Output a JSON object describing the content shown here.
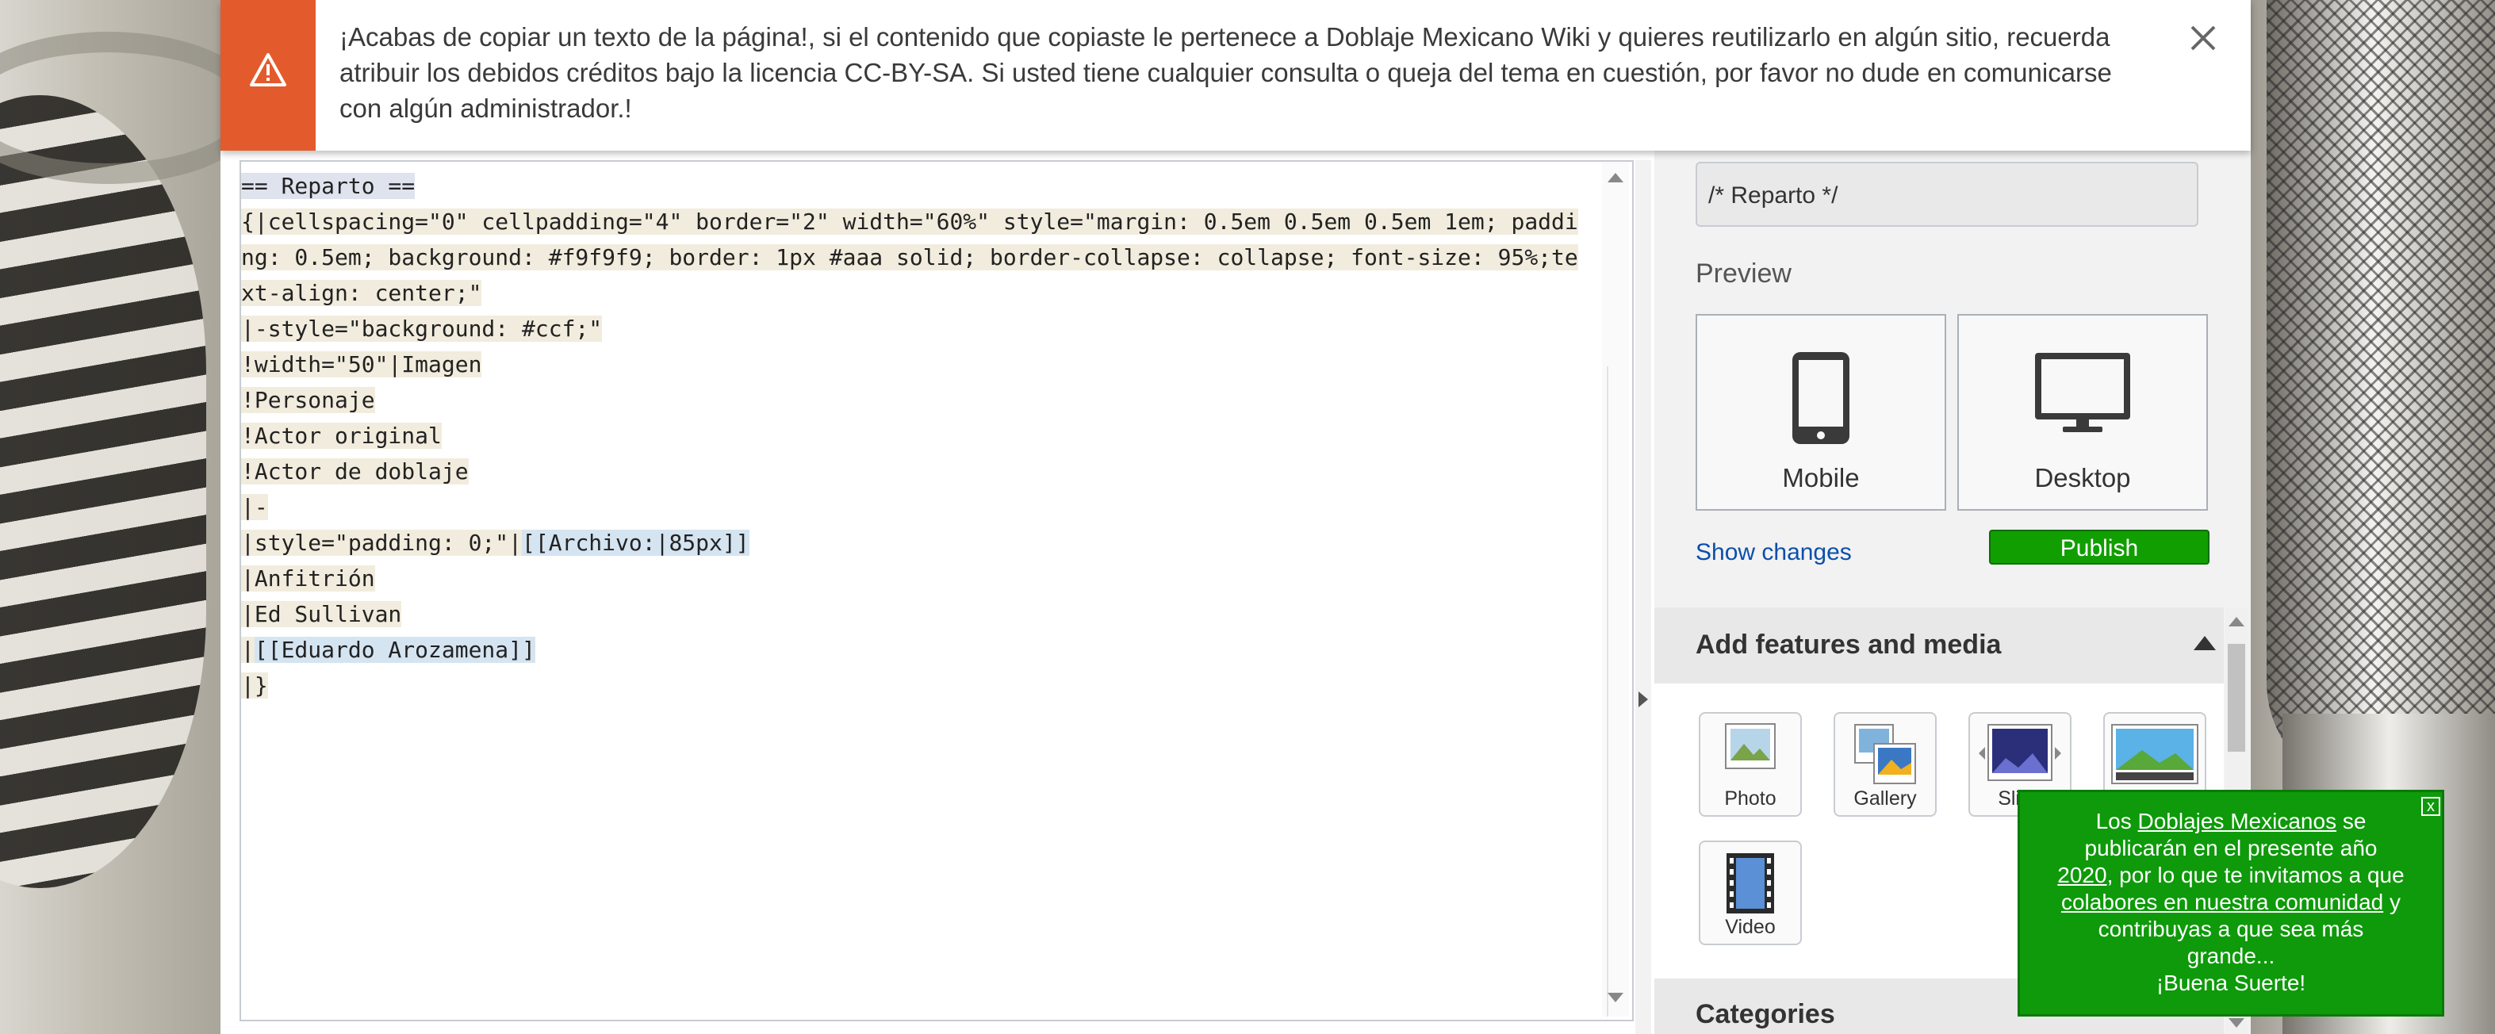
{
  "notice": {
    "message": "¡Acabas de copiar un texto de la página!, si el contenido que copiaste le pertenece a Doblaje Mexicano Wiki y quieres reutilizarlo en algún sitio, recuerda atribuir los debidos créditos bajo la licencia CC-BY-SA. Si usted tiene cualquier consulta o queja del tema en cuestión, por favor no dude en comunicarse con algún administrador.!",
    "accent_color": "#e35b2c",
    "icon": "warning-icon"
  },
  "source": {
    "lines": [
      {
        "text": "== Reparto ==",
        "style": "head"
      },
      {
        "text": "{|cellspacing=\"0\" cellpadding=\"4\" border=\"2\" width=\"60%\" style=\"margin: 0.5em 0.5em 0.5em 1em; padding: 0.5em; background: #f9f9f9; border: 1px #aaa solid; border-collapse: collapse; font-size: 95%;text-align: center;\"",
        "style": "hl"
      },
      {
        "text": "|-style=\"background: #ccf;\"",
        "style": "hl"
      },
      {
        "text": "!width=\"50\"|Imagen",
        "style": "hl"
      },
      {
        "text": "!Personaje",
        "style": "hl"
      },
      {
        "text": "!Actor original",
        "style": "hl"
      },
      {
        "text": "!Actor de doblaje",
        "style": "hl"
      },
      {
        "text": "|-",
        "style": "hl"
      },
      {
        "text": "|style=\"padding: 0;\"|",
        "style": "hl",
        "link": "[[Archivo:|85px]]"
      },
      {
        "text": "|Anfitrión",
        "style": "hl"
      },
      {
        "text": "|Ed Sullivan",
        "style": "hl"
      },
      {
        "text": "|",
        "style": "hl",
        "link": "[[Eduardo Arozamena]]"
      },
      {
        "text": "|}",
        "style": "hl"
      }
    ]
  },
  "sidebar": {
    "summary_value": "/* Reparto */",
    "preview_label": "Preview",
    "preview_mobile": "Mobile",
    "preview_desktop": "Desktop",
    "show_changes": "Show changes",
    "publish": "Publish",
    "publish_color": "#119e00",
    "features_title": "Add features and media",
    "tools": [
      {
        "label": "Photo",
        "icon": "photo-icon"
      },
      {
        "label": "Gallery",
        "icon": "gallery-icon"
      },
      {
        "label": "Slide",
        "icon": "slideshow-icon"
      },
      {
        "label": "",
        "icon": "slider-icon"
      },
      {
        "label": "Video",
        "icon": "video-icon"
      }
    ],
    "categories_title": "Categories"
  },
  "promo": {
    "t1": "Los ",
    "link1": "Doblajes Mexicanos",
    "t2": " se publicarán en el presente año ",
    "link2": "2020",
    "t3": ", por lo que te invitamos a que ",
    "link3": "colabores en nuestra comunidad",
    "t4": " y contribuyas a que sea más grande...",
    "t5": "¡Buena Suerte!",
    "close": "x",
    "bg_color": "#0e9a0a"
  }
}
